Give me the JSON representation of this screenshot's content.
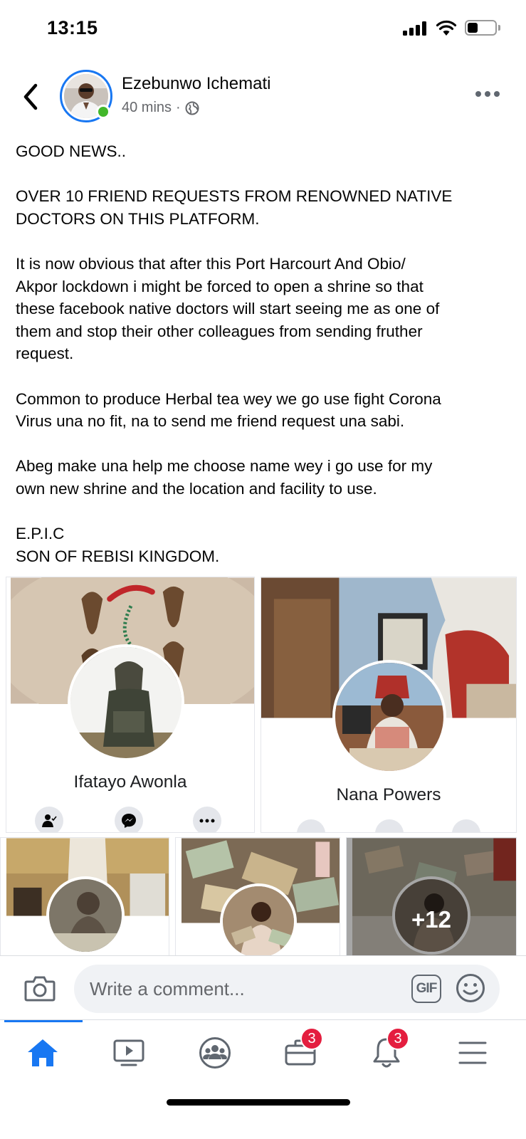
{
  "status_bar": {
    "time": "13:15"
  },
  "post": {
    "author": "Ezebunwo Ichemati",
    "time": "40 mins",
    "separator": "·",
    "paragraphs": [
      "GOOD NEWS..",
      "OVER 10 FRIEND REQUESTS FROM RENOWNED NATIVE\nDOCTORS ON THIS PLATFORM.",
      "It is now obvious that after this Port Harcourt And Obio/\nAkpor lockdown i might be forced to open a shrine so that\nthese facebook native doctors will start seeing me as one of\nthem and stop their other colleagues from sending fruther\nrequest.",
      "Common to produce Herbal tea wey we go use fight Corona\nVirus una no fit, na to send me friend request una sabi.",
      "Abeg make una help me choose name wey i go use for my\nown new shrine and the location and facility to use.",
      "E.P.I.C\nSON OF REBISI KINGDOM."
    ]
  },
  "photos": {
    "cards": [
      {
        "name": "Ifatayo Awonla"
      },
      {
        "name": "Nana Powers"
      }
    ],
    "more_count": "+12"
  },
  "comment": {
    "placeholder": "Write a comment...",
    "gif_label": "GIF"
  },
  "tabs": {
    "marketplace_badge": "3",
    "notifications_badge": "3"
  },
  "colors": {
    "accent": "#1877f2",
    "badge": "#e41e3f",
    "online": "#42b72a"
  }
}
